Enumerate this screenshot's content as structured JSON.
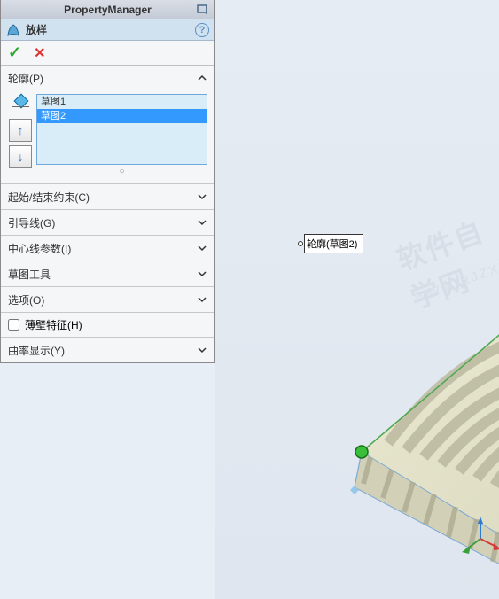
{
  "header": {
    "title": "PropertyManager"
  },
  "feature": {
    "name": "放样"
  },
  "profiles": {
    "title": "轮廓(P)",
    "items": [
      "草图1",
      "草图2"
    ],
    "selected_index": 1
  },
  "sections": {
    "constraints": "起始/结束约束(C)",
    "guides": "引导线(G)",
    "centerline": "中心线参数(I)",
    "sketchtools": "草图工具",
    "options": "选项(O)",
    "curvature": "曲率显示(Y)"
  },
  "thinwall": {
    "label": "薄壁特征(H)",
    "checked": false
  },
  "callout": {
    "text": "轮廓(草图2)"
  }
}
